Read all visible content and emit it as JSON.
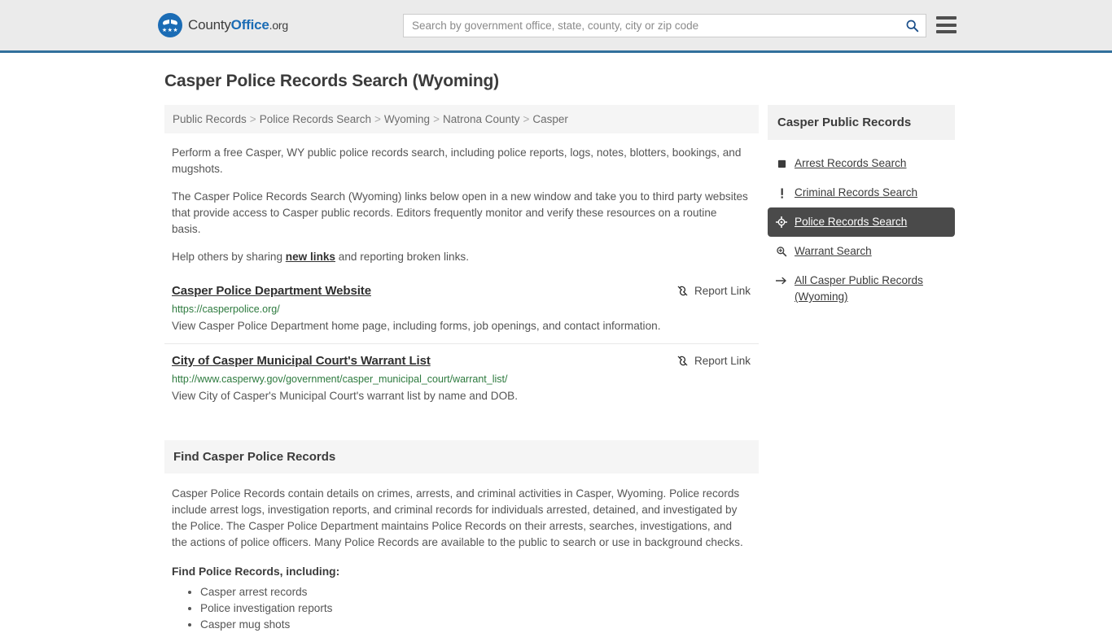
{
  "header": {
    "brand": {
      "part1": "County",
      "part2": "Office",
      "part3": ".org",
      "logo_icon": "eagle-shield-logo",
      "stars": "★★★"
    },
    "search": {
      "placeholder": "Search by government office, state, county, city or zip code",
      "value": "",
      "icon": "search-icon"
    },
    "menu_icon": "hamburger-menu-icon",
    "accent_color": "#31709c",
    "background_color": "#ebebeb"
  },
  "page": {
    "title": "Casper Police Records Search (Wyoming)"
  },
  "breadcrumb": {
    "items": [
      {
        "label": "Public Records"
      },
      {
        "label": "Police Records Search"
      },
      {
        "label": "Wyoming"
      },
      {
        "label": "Natrona County"
      },
      {
        "label": "Casper"
      }
    ],
    "separator": ">"
  },
  "intro": {
    "p1": "Perform a free Casper, WY public police records search, including police reports, logs, notes, blotters, bookings, and mugshots.",
    "p2": "The Casper Police Records Search (Wyoming) links below open in a new window and take you to third party websites that provide access to Casper public records. Editors frequently monitor and verify these resources on a routine basis.",
    "p3_before": "Help others by sharing ",
    "p3_link": "new links",
    "p3_after": " and reporting broken links."
  },
  "results": {
    "report_label": "Report Link",
    "report_icon": "broken-link-icon",
    "items": [
      {
        "title": "Casper Police Department Website",
        "url": "https://casperpolice.org/",
        "description": "View Casper Police Department home page, including forms, job openings, and contact information."
      },
      {
        "title": "City of Casper Municipal Court's Warrant List",
        "url": "http://www.casperwy.gov/government/casper_municipal_court/warrant_list/",
        "description": "View City of Casper's Municipal Court's warrant list by name and DOB."
      }
    ]
  },
  "find_section": {
    "heading": "Find Casper Police Records",
    "body": "Casper Police Records contain details on crimes, arrests, and criminal activities in Casper, Wyoming. Police records include arrest logs, investigation reports, and criminal records for individuals arrested, detained, and investigated by the Police. The Casper Police Department maintains Police Records on their arrests, searches, investigations, and the actions of police officers. Many Police Records are available to the public to search or use in background checks.",
    "sub_heading": "Find Police Records, including:",
    "bullets": [
      "Casper arrest records",
      "Police investigation reports",
      "Casper mug shots"
    ]
  },
  "sidebar": {
    "title": "Casper Public Records",
    "active_bg": "#4a4a4a",
    "items": [
      {
        "label": "Arrest Records Search",
        "icon": "filled-square-icon",
        "glyph": "■",
        "active": false
      },
      {
        "label": "Criminal Records Search",
        "icon": "exclamation-icon",
        "glyph": "!",
        "active": false
      },
      {
        "label": "Police Records Search",
        "icon": "crosshair-target-icon",
        "glyph": "✛",
        "active": true
      },
      {
        "label": "Warrant Search",
        "icon": "magnifier-plus-icon",
        "glyph": "⌕",
        "active": false
      },
      {
        "label": "All Casper Public Records (Wyoming)",
        "icon": "arrow-right-icon",
        "glyph": "→",
        "active": false
      }
    ]
  }
}
